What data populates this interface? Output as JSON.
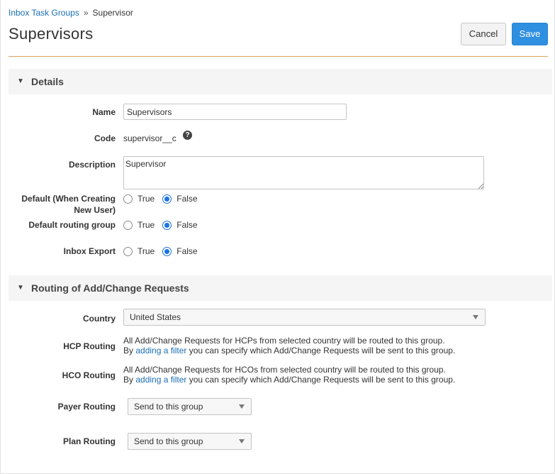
{
  "breadcrumb": {
    "parent": "Inbox Task Groups",
    "separator": "»",
    "current": "Supervisor"
  },
  "page_title": "Supervisors",
  "toolbar": {
    "cancel_label": "Cancel",
    "save_label": "Save"
  },
  "details": {
    "header": "Details",
    "name_label": "Name",
    "name_value": "Supervisors",
    "code_label": "Code",
    "code_value": "supervisor__c",
    "description_label": "Description",
    "description_value": "Supervisor",
    "default_new_user_label_1": "Default (When Creating",
    "default_new_user_label_2": "New User)",
    "default_routing_label": "Default routing group",
    "inbox_export_label": "Inbox Export",
    "true_label": "True",
    "false_label": "False"
  },
  "routing": {
    "header": "Routing of Add/Change Requests",
    "country_label": "Country",
    "country_value": "United States",
    "hcp_label": "HCP Routing",
    "hcp_line1": "All Add/Change Requests for HCPs from selected country will be routed to this group.",
    "hco_label": "HCO Routing",
    "hco_line1": "All Add/Change Requests for HCOs from selected country will be routed to this group.",
    "filter_prefix": "By ",
    "filter_link": "adding a filter",
    "filter_suffix": " you can specify which Add/Change Requests will be sent to this group.",
    "payer_label": "Payer Routing",
    "payer_value": "Send to this group",
    "plan_label": "Plan Routing",
    "plan_value": "Send to this group"
  },
  "colors": {
    "accent": "#2f8fe0",
    "link": "#1a6fb5",
    "title_rule": "#d9a661",
    "section_bg": "#f5f5f5"
  },
  "icons": {
    "help": "question-circle-icon",
    "collapse": "triangle-down-icon",
    "caret": "caret-down-icon"
  }
}
